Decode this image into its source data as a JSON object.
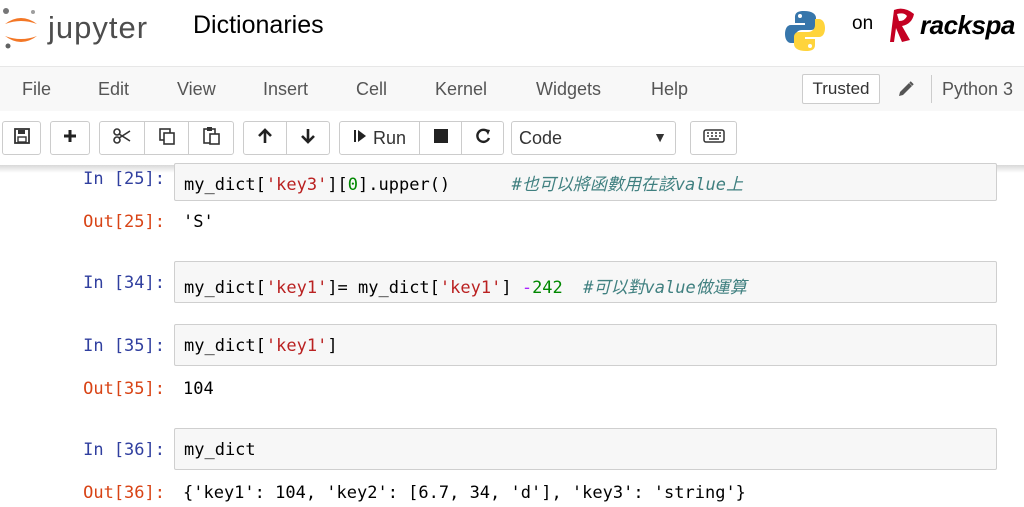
{
  "header": {
    "logo_text": "jupyter",
    "notebook_title": "Dictionaries",
    "on_text": "on",
    "rackspace_text": "rackspa"
  },
  "menu": [
    "File",
    "Edit",
    "View",
    "Insert",
    "Cell",
    "Kernel",
    "Widgets",
    "Help"
  ],
  "trusted_label": "Trusted",
  "kernel_name": "Python 3",
  "toolbar": {
    "run_label": "Run",
    "cell_type": "Code"
  },
  "colors": {
    "in_prompt": "#303f9f",
    "out_prompt": "#d84315",
    "string": "#ba2121",
    "number": "#008800",
    "comment": "#408080"
  },
  "cells": [
    {
      "in_prompt": "In [25]:",
      "code": {
        "a": "my_dict[",
        "b": "'key3'",
        "c": "][",
        "d": "0",
        "e": "].upper()      ",
        "f": "#也可以將函數用在該value上"
      },
      "out_prompt": "Out[25]:",
      "output": "'S'"
    },
    {
      "in_prompt": "In [34]:",
      "code": {
        "a": "my_dict[",
        "b": "'key1'",
        "c": "]= my_dict[",
        "d": "'key1'",
        "e": "] ",
        "f": "-",
        "g": "242",
        "h": "  ",
        "i": "#可以對value做運算"
      }
    },
    {
      "in_prompt": "In [35]:",
      "code": {
        "a": "my_dict[",
        "b": "'key1'",
        "c": "]"
      },
      "out_prompt": "Out[35]:",
      "output": "104"
    },
    {
      "in_prompt": "In [36]:",
      "code": {
        "a": "my_dict"
      },
      "out_prompt": "Out[36]:",
      "output": "{'key1': 104, 'key2': [6.7, 34, 'd'], 'key3': 'string'}"
    }
  ]
}
